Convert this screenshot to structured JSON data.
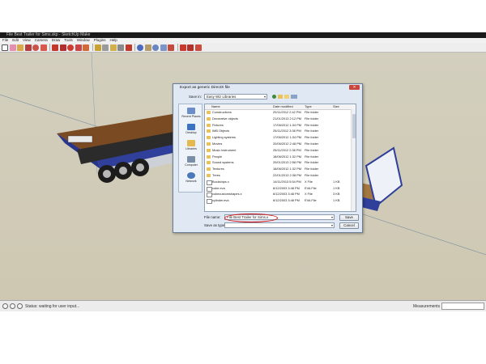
{
  "window": {
    "title": "File Best Trailer for Sims.skp - SketchUp Make"
  },
  "menu": [
    "File",
    "Edit",
    "View",
    "Camera",
    "Draw",
    "Tools",
    "Window",
    "Plugins",
    "Help"
  ],
  "colors": {
    "accent_ring": "#d40f0f",
    "folder": "#e8c35a",
    "deck": "#7a4a22",
    "trailer_body": "#2f3f9a"
  },
  "toolbar_icons": [
    "select-icon",
    "eraser-icon",
    "pencil-icon",
    "line-icon",
    "arc-icon",
    "shape-icon",
    "pushpull-icon",
    "move-icon",
    "rotate-icon",
    "scale-icon",
    "offset-icon",
    "tape-icon",
    "dimension-icon",
    "protractor-icon",
    "text-icon",
    "axes-icon",
    "orbit-icon",
    "pan-icon",
    "zoom-icon",
    "zoom-window-icon",
    "zoom-extents-icon",
    "warehouse-icon",
    "components-icon",
    "share-icon"
  ],
  "status": {
    "text": "Status: waiting for user input...",
    "measurements_label": "Measurements"
  },
  "dialog": {
    "title": "Export as generic DirectX file",
    "save_in_label": "Save in:",
    "save_in_value": "Easy Wiz Libraries",
    "places": [
      "Recent Places",
      "Desktop",
      "Libraries",
      "Computer",
      "Network"
    ],
    "columns": [
      "Name",
      "Date modified",
      "Type",
      "Size"
    ],
    "rows": [
      {
        "name": "Constructions",
        "date": "20/11/2012 2:42 PM",
        "type": "File folder",
        "size": "",
        "kind": "folder"
      },
      {
        "name": "Decorative objects",
        "date": "21/01/2013 2:12 PM",
        "type": "File folder",
        "size": "",
        "kind": "folder"
      },
      {
        "name": "Fixtures",
        "date": "17/06/2012 1:34 PM",
        "type": "File folder",
        "size": "",
        "kind": "folder"
      },
      {
        "name": "IMB Objects",
        "date": "25/11/2012 3:38 PM",
        "type": "File folder",
        "size": "",
        "kind": "folder"
      },
      {
        "name": "Lighting systems",
        "date": "17/06/2012 1:34 PM",
        "type": "File folder",
        "size": "",
        "kind": "folder"
      },
      {
        "name": "Movies",
        "date": "20/06/2012 2:48 PM",
        "type": "File folder",
        "size": "",
        "kind": "folder"
      },
      {
        "name": "Music instrument",
        "date": "25/11/2012 2:38 PM",
        "type": "File folder",
        "size": "",
        "kind": "folder"
      },
      {
        "name": "People",
        "date": "18/06/2012 1:32 PM",
        "type": "File folder",
        "size": "",
        "kind": "folder"
      },
      {
        "name": "Sound systems",
        "date": "20/01/2013 2:58 PM",
        "type": "File folder",
        "size": "",
        "kind": "folder"
      },
      {
        "name": "Textures",
        "date": "18/06/2012 1:32 PM",
        "type": "File folder",
        "size": "",
        "kind": "folder"
      },
      {
        "name": "Trees",
        "date": "22/01/2013 2:38 PM",
        "type": "File folder",
        "size": "",
        "kind": "folder"
      },
      {
        "name": "Bockships.x",
        "date": "14/11/2013 5:54 PM",
        "type": "X File",
        "size": "1 KB",
        "kind": "file"
      },
      {
        "name": "cube.eva",
        "date": "6/12/2003 3:48 PM",
        "type": "EVA File",
        "size": "1 KB",
        "kind": "file"
      },
      {
        "name": "cubecustomshapes.x",
        "date": "6/12/2003 3:48 PM",
        "type": "X File",
        "size": "3 KB",
        "kind": "file"
      },
      {
        "name": "cylinder.eva",
        "date": "6/12/2003 3:48 PM",
        "type": "EVA File",
        "size": "1 KB",
        "kind": "file"
      }
    ],
    "file_name_label": "File name:",
    "file_name_value": "File Best Trailer for Sims.x",
    "save_type_label": "Save as type:",
    "save_type_value": "",
    "save_button": "Save",
    "cancel_button": "Cancel"
  }
}
